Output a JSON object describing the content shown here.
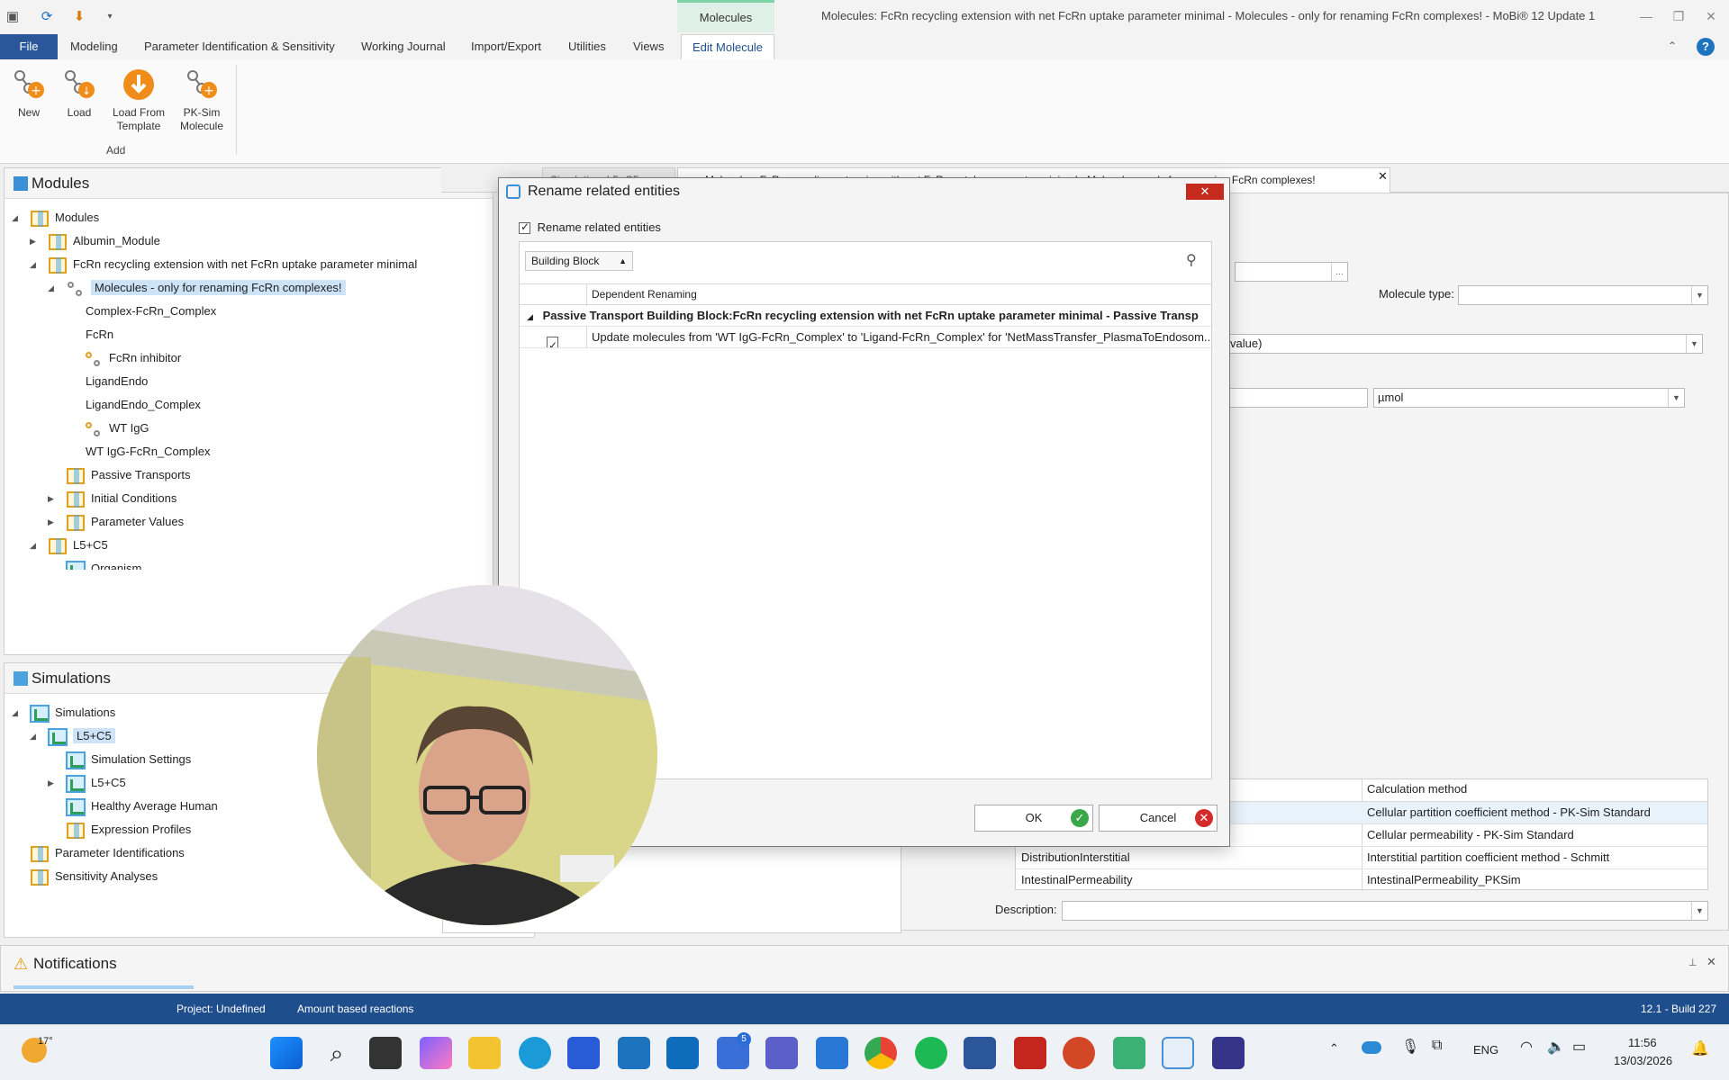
{
  "window": {
    "title": "Molecules: FcRn recycling extension with net FcRn uptake parameter minimal - Molecules - only for renaming FcRn complexes! - MoBi® 12 Update 1",
    "context_tab": "Molecules"
  },
  "ribbon": {
    "tabs": [
      "File",
      "Modeling",
      "Parameter Identification & Sensitivity",
      "Working Journal",
      "Import/Export",
      "Utilities",
      "Views",
      "Edit Molecule"
    ],
    "active_tab": "Edit Molecule",
    "buttons": {
      "new": "New",
      "load": "Load",
      "load_template_1": "Load From",
      "load_template_2": "Template",
      "pksim_1": "PK-Sim",
      "pksim_2": "Molecule"
    },
    "group_label": "Add"
  },
  "modules_panel": {
    "title": "Modules",
    "items": {
      "root": "Modules",
      "albumin": "Albumin_Module",
      "fcrn_module": "FcRn recycling extension with net FcRn uptake parameter minimal",
      "molecules_bb": "Molecules - only for renaming FcRn complexes!",
      "complex": "Complex-FcRn_Complex",
      "fcrn": "FcRn",
      "fcrn_inhibitor": "FcRn inhibitor",
      "ligandendo": "LigandEndo",
      "ligandendo_complex": "LigandEndo_Complex",
      "wt_igg": "WT IgG",
      "wt_igg_complex": "WT IgG-FcRn_Complex",
      "passive": "Passive Transports",
      "initial": "Initial Conditions",
      "param_values": "Parameter Values",
      "l5c5": "L5+C5",
      "organism": "Organism"
    }
  },
  "simulations_panel": {
    "title": "Simulations",
    "items": {
      "root": "Simulations",
      "l5c5_sim": "L5+C5",
      "settings": "Simulation Settings",
      "l5c5_child": "L5+C5",
      "human": "Healthy Average Human",
      "expression": "Expression Profiles",
      "param_ident": "Parameter Identifications",
      "sensitivity": "Sensitivity Analyses"
    }
  },
  "doc_tabs": {
    "tab1": "Simulation: L5+C5",
    "tab2": "Molecules: FcRn recycling extension with net FcRn uptake parameter minimal - Molecules - only for renaming FcRn complexes!"
  },
  "main": {
    "molecule_type_label": "Molecule type:",
    "molecule_type_value": "",
    "value_field_tail": "value)",
    "unit": "µmol",
    "calc_header": "Calculation method",
    "calc_rows": [
      {
        "param": "",
        "method": "Cellular partition coefficient method - PK-Sim Standard"
      },
      {
        "param": "",
        "method": "Cellular permeability - PK-Sim Standard"
      },
      {
        "param": "DistributionInterstitial",
        "method": "Interstitial partition coefficient method - Schmitt"
      },
      {
        "param": "IntestinalPermeability",
        "method": "IntestinalPermeability_PKSim"
      }
    ],
    "description_label": "Description:"
  },
  "dialog": {
    "title": "Rename related entities",
    "checkbox_label": "Rename related entities",
    "group_by": "Building Block",
    "column_header": "Dependent Renaming",
    "group_row": "Passive Transport Building Block:FcRn recycling extension with net FcRn uptake parameter minimal - Passive Transp",
    "row_text": "Update molecules from 'WT IgG-FcRn_Complex' to 'Ligand-FcRn_Complex' for  'NetMassTransfer_PlasmaToEndosom...",
    "ok_label": "OK",
    "cancel_label": "Cancel"
  },
  "notifications": {
    "title": "Notifications"
  },
  "statusbar": {
    "project": "Project: Undefined",
    "mode": "Amount based reactions",
    "build": "12.1 - Build 227"
  },
  "taskbar": {
    "weather": "17°",
    "language": "ENG",
    "time": "11:56",
    "date": "13/03/2026",
    "badge": "5"
  }
}
